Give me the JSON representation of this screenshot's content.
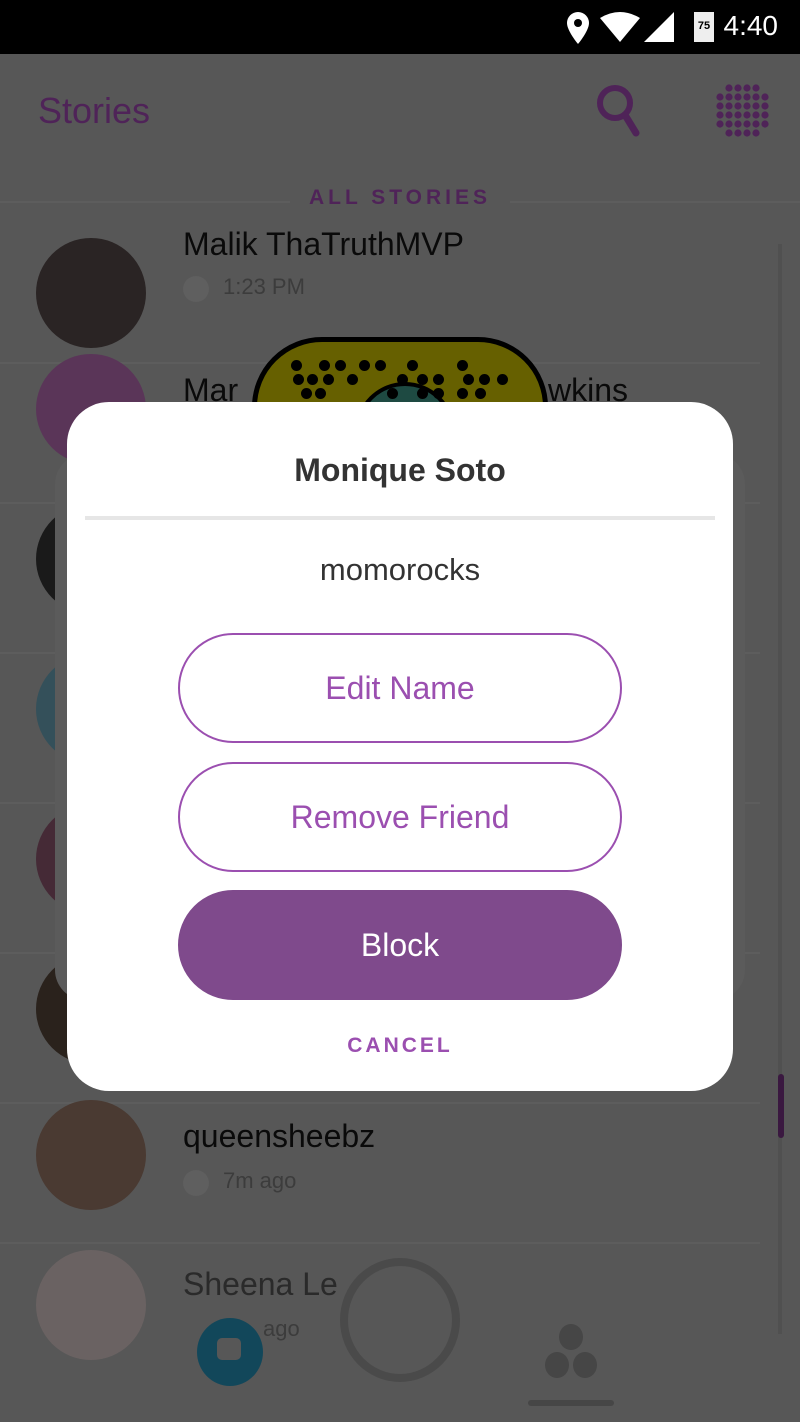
{
  "status_bar": {
    "time": "4:40",
    "battery": "75",
    "icons": [
      "location-icon",
      "wifi-icon",
      "signal-icon",
      "battery-icon"
    ]
  },
  "header": {
    "title": "Stories",
    "search_icon": "search-icon",
    "snapcode_icon": "snapcode-icon"
  },
  "section_label": "ALL STORIES",
  "stories": [
    {
      "name": "Malik ThaTruthMVP",
      "time": "1:23 PM"
    },
    {
      "name_start": "Mar",
      "name_end": "wkins",
      "time": ""
    },
    {
      "name": "",
      "time": ""
    },
    {
      "name": "",
      "time": ""
    },
    {
      "name": "",
      "time": ""
    },
    {
      "name": "",
      "time": ""
    },
    {
      "name": "queensheebz",
      "time": "7m ago"
    },
    {
      "name": "Sheena Le",
      "time": "ago"
    }
  ],
  "dialog": {
    "title": "Monique Soto",
    "username": "momorocks",
    "edit_name": "Edit Name",
    "remove_friend": "Remove Friend",
    "block": "Block",
    "cancel": "CANCEL"
  },
  "colors": {
    "accent": "#9b4fb0",
    "block_fill": "#7f4a8c",
    "chat": "#2ea4cf",
    "snapcode": "#fffc00"
  }
}
